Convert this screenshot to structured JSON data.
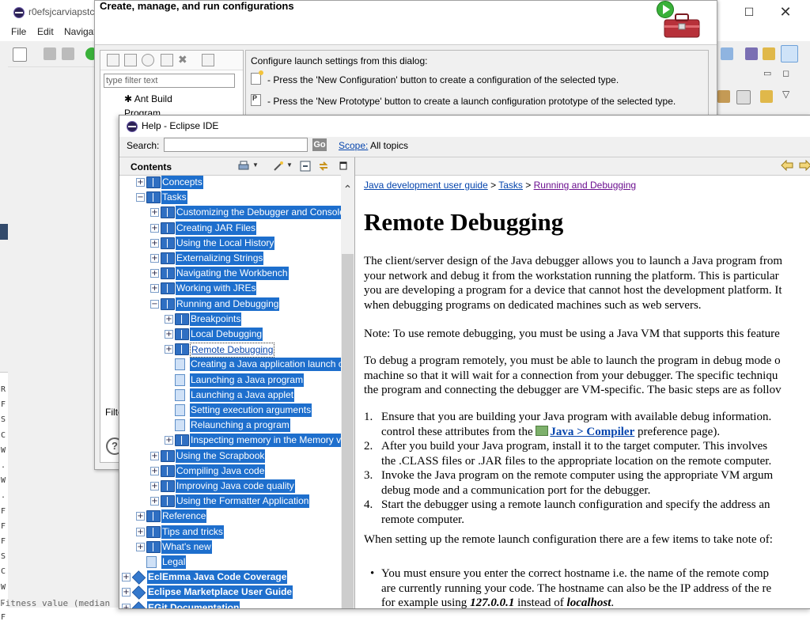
{
  "eclipse": {
    "title": "r0efsjcarviapstc",
    "menu": [
      "File",
      "Edit",
      "Navigat"
    ],
    "console_chars": "R\nF\nS\nC\nW\n.\nW\n.\nF\nF\nF\nS\nC\nW\n.\nF",
    "console_line": "Fitness value (median"
  },
  "run_dialog": {
    "title": "Create, manage, and run configurations",
    "filter_placeholder": "type filter text",
    "tree": [
      "Ant Build",
      "Program"
    ],
    "filter_label": "Filte",
    "intro": "Configure launch settings from this dialog:",
    "line1": "- Press the 'New Configuration' button to create a configuration of the selected type.",
    "line2": "- Press the 'New Prototype' button to create a launch configuration prototype of the selected type.",
    "help": "?"
  },
  "help_window": {
    "title": "Help - Eclipse IDE",
    "search_label": "Search:",
    "go_label": "Go",
    "scope_link": "Scope:",
    "scope_value": "All topics",
    "contents_title": "Contents"
  },
  "toc": [
    {
      "label": "Concepts",
      "level": 1,
      "toggle": "+",
      "icon": "book"
    },
    {
      "label": "Tasks",
      "level": 1,
      "toggle": "−",
      "icon": "book"
    },
    {
      "label": "Customizing the Debugger and Console",
      "level": 2,
      "toggle": "+",
      "icon": "book"
    },
    {
      "label": "Creating JAR Files",
      "level": 2,
      "toggle": "+",
      "icon": "book"
    },
    {
      "label": "Using the Local History",
      "level": 2,
      "toggle": "+",
      "icon": "book"
    },
    {
      "label": "Externalizing Strings",
      "level": 2,
      "toggle": "+",
      "icon": "book"
    },
    {
      "label": "Navigating the Workbench",
      "level": 2,
      "toggle": "+",
      "icon": "book"
    },
    {
      "label": "Working with JREs",
      "level": 2,
      "toggle": "+",
      "icon": "book"
    },
    {
      "label": "Running and Debugging",
      "level": 2,
      "toggle": "−",
      "icon": "book"
    },
    {
      "label": "Breakpoints",
      "level": 3,
      "toggle": "+",
      "icon": "book"
    },
    {
      "label": "Local Debugging",
      "level": 3,
      "toggle": "+",
      "icon": "book"
    },
    {
      "label": "Remote Debugging",
      "level": 3,
      "toggle": "+",
      "icon": "book",
      "selected": true
    },
    {
      "label": "Creating a Java application launch co",
      "level": 3,
      "toggle": "",
      "icon": "page"
    },
    {
      "label": "Launching a Java program",
      "level": 3,
      "toggle": "",
      "icon": "page"
    },
    {
      "label": "Launching a Java applet",
      "level": 3,
      "toggle": "",
      "icon": "page"
    },
    {
      "label": "Setting execution arguments",
      "level": 3,
      "toggle": "",
      "icon": "page"
    },
    {
      "label": "Relaunching a program",
      "level": 3,
      "toggle": "",
      "icon": "page"
    },
    {
      "label": "Inspecting memory in the Memory v",
      "level": 3,
      "toggle": "+",
      "icon": "book"
    },
    {
      "label": "Using the Scrapbook",
      "level": 2,
      "toggle": "+",
      "icon": "book"
    },
    {
      "label": "Compiling Java code",
      "level": 2,
      "toggle": "+",
      "icon": "book"
    },
    {
      "label": "Improving Java code quality",
      "level": 2,
      "toggle": "+",
      "icon": "book"
    },
    {
      "label": "Using the Formatter Application",
      "level": 2,
      "toggle": "+",
      "icon": "book"
    },
    {
      "label": "Reference",
      "level": 1,
      "toggle": "+",
      "icon": "book"
    },
    {
      "label": "Tips and tricks",
      "level": 1,
      "toggle": "+",
      "icon": "book"
    },
    {
      "label": "What's new",
      "level": 1,
      "toggle": "+",
      "icon": "book"
    },
    {
      "label": "Legal",
      "level": 1,
      "toggle": "",
      "icon": "page"
    },
    {
      "label": "EclEmma Java Code Coverage",
      "level": 0,
      "toggle": "+",
      "icon": "gem",
      "bold": true
    },
    {
      "label": "Eclipse Marketplace User Guide",
      "level": 0,
      "toggle": "+",
      "icon": "gem",
      "bold": true
    },
    {
      "label": "EGit Documentation",
      "level": 0,
      "toggle": "+",
      "icon": "gem",
      "bold": true
    }
  ],
  "article": {
    "breadcrumb": [
      "Java development user guide",
      "Tasks",
      "Running and Debugging"
    ],
    "heading": "Remote Debugging",
    "p1": [
      "The client/server design of the Java debugger allows you to launch a Java program from",
      "your network and debug it from the workstation running the platform.  This is particular",
      "you are developing a program for a device that cannot host the development platform.  It",
      "when debugging programs on dedicated machines such as web servers."
    ],
    "note": "Note:  To use remote debugging, you must be using a Java VM that supports this feature",
    "p2": [
      "To debug a program remotely, you must be able to launch the program in debug mode o",
      "machine so that it will wait for a connection from your debugger.  The specific techniqu",
      "the program and connecting the debugger are VM-specific.  The basic steps are as follov"
    ],
    "step1a": "Ensure that you are building your Java program with available debug information.",
    "step1b_pre": "control these attributes from the",
    "step1b_link": "Java > Compiler",
    "step1b_post": "preference page).",
    "step2a": "After you build your Java program, install it to the target computer.  This involves",
    "step2b": "the .CLASS files or .JAR files to the appropriate location on the remote computer.",
    "step3a": "Invoke the Java program on the remote computer using the appropriate VM argum",
    "step3b": "debug mode and a communication port for the debugger.",
    "step4a": "Start the debugger using a remote launch configuration and specify the address an",
    "step4b": "remote computer.",
    "setup": "When setting up the remote launch configuration there are a few items to take note of:",
    "bullet1a": "You must ensure you enter the correct hostname i.e. the name of the remote comp",
    "bullet1b": "are currently running your code. The hostname can also be the IP address of the re",
    "bullet1c_pre": "for example using",
    "bullet1c_ip": "127.0.0.1",
    "bullet1c_mid": "instead of",
    "bullet1c_host": "localhost",
    "bullet1c_end": "."
  }
}
